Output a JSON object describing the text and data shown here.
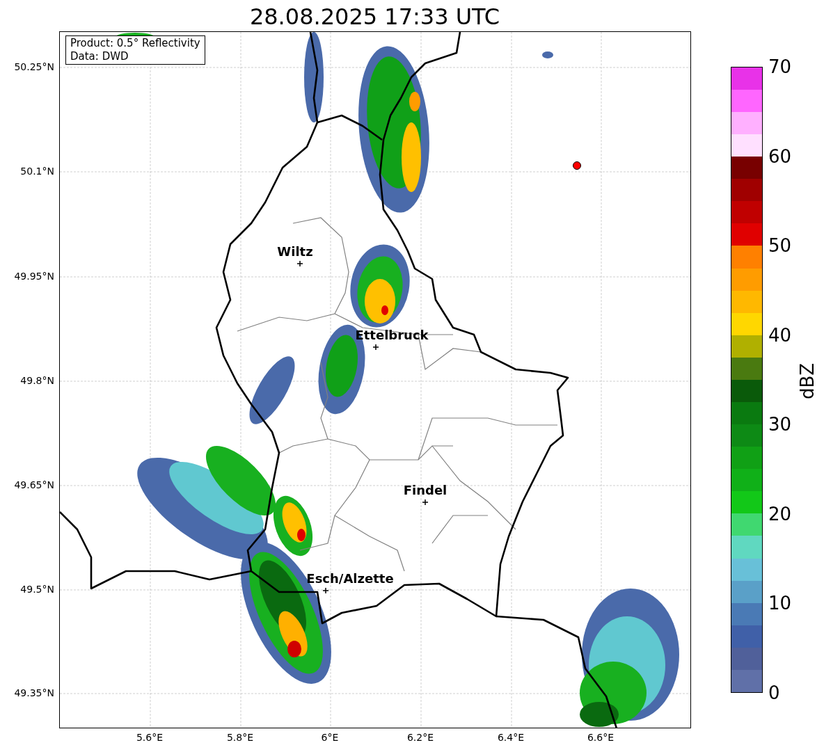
{
  "title": "28.08.2025 17:33 UTC",
  "info_box": {
    "lines": [
      "Product: 0.5° Reflectivity",
      "Data: DWD"
    ]
  },
  "map": {
    "x_ticks": [
      "5.6°E",
      "5.8°E",
      "6°E",
      "6.2°E",
      "6.4°E",
      "6.6°E"
    ],
    "y_ticks": [
      "50.25°N",
      "50.1°N",
      "49.95°N",
      "49.8°N",
      "49.65°N",
      "49.5°N",
      "49.35°N"
    ],
    "cities": [
      {
        "label": "Wiltz"
      },
      {
        "label": "Ettelbruck"
      },
      {
        "label": "Findel"
      },
      {
        "label": "Esch/Alzette"
      }
    ]
  },
  "colorbar": {
    "label": "dBZ",
    "ticks": [
      "70",
      "60",
      "50",
      "40",
      "30",
      "20",
      "10",
      "0"
    ],
    "bins": [
      {
        "color": "#6070a8"
      },
      {
        "color": "#50609a"
      },
      {
        "color": "#4060a8"
      },
      {
        "color": "#4a7ab5"
      },
      {
        "color": "#5aa0c8"
      },
      {
        "color": "#68c0d8"
      },
      {
        "color": "#60d8c0"
      },
      {
        "color": "#40d870"
      },
      {
        "color": "#12c818"
      },
      {
        "color": "#10b018"
      },
      {
        "color": "#10a015"
      },
      {
        "color": "#0d8a15"
      },
      {
        "color": "#0a7a10"
      },
      {
        "color": "#0a5a0a"
      },
      {
        "color": "#4a7a10"
      },
      {
        "color": "#b0b000"
      },
      {
        "color": "#ffd700"
      },
      {
        "color": "#ffb800"
      },
      {
        "color": "#ff9c00"
      },
      {
        "color": "#ff8000"
      },
      {
        "color": "#e00000"
      },
      {
        "color": "#c00000"
      },
      {
        "color": "#a00000"
      },
      {
        "color": "#780000"
      },
      {
        "color": "#ffe0ff"
      },
      {
        "color": "#ffb0ff"
      },
      {
        "color": "#ff66ff"
      },
      {
        "color": "#e832e8"
      }
    ]
  }
}
